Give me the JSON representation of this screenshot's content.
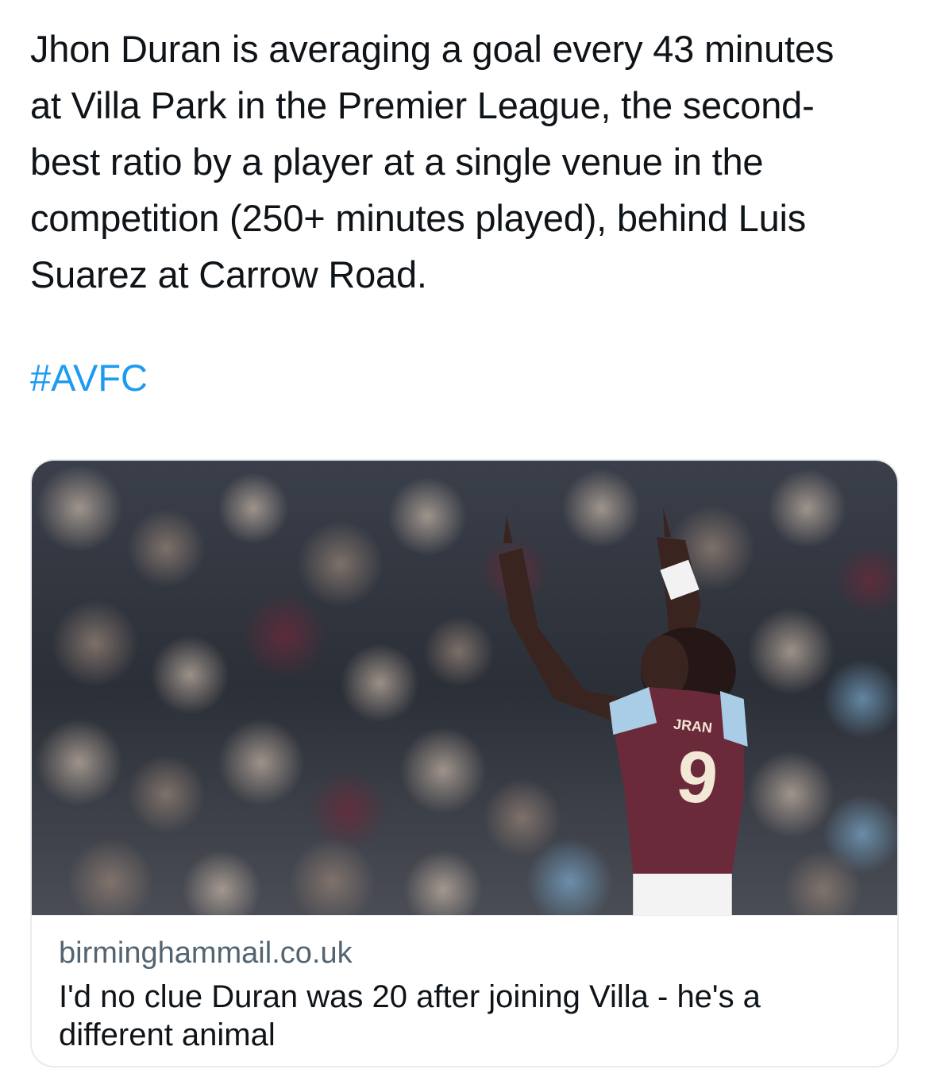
{
  "tweet": {
    "text_lines": [
      "Jhon Duran is averaging a goal every 43 minutes",
      "at Villa Park in the Premier League, the second-",
      "best ratio by a player at a single venue in the",
      "competition (250+ minutes played), behind Luis",
      "Suarez at Carrow Road."
    ],
    "hashtag": "#AVFC"
  },
  "link_card": {
    "image": {
      "shirt_number": "9",
      "shirt_name": "JRAN"
    },
    "domain": "birminghammail.co.uk",
    "title": "I'd no clue Duran was 20 after joining Villa - he's a different animal"
  },
  "colors": {
    "text": "#0f1419",
    "link": "#1d9bf0",
    "muted": "#536471",
    "border": "#e6ecf0"
  }
}
